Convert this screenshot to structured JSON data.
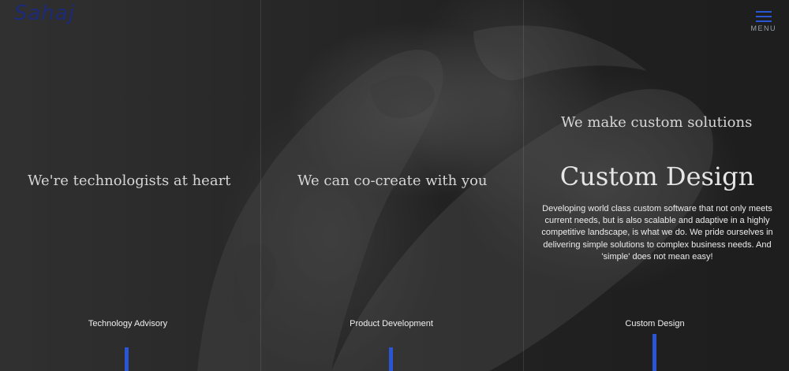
{
  "brand": {
    "logo_text": "Sahaj",
    "logo_color": "#1d2a78"
  },
  "header": {
    "menu_label": "MENU",
    "menu_icon": "hamburger-icon",
    "accent_color": "#2a55d4"
  },
  "columns": [
    {
      "headline": "We're technologists at heart",
      "tab_label": "Technology Advisory"
    },
    {
      "headline": "We can co-create with you",
      "tab_label": "Product Development"
    },
    {
      "headline": "We make custom solutions",
      "tab_label": "Custom Design",
      "feature_title": "Custom Design",
      "feature_body": "Developing world class custom software that not only meets current needs, but is also scalable and adaptive in a highly competitive landscape, is what we do. We pride ourselves in delivering simple solutions to complex business needs. And 'simple' does not mean easy!"
    }
  ]
}
